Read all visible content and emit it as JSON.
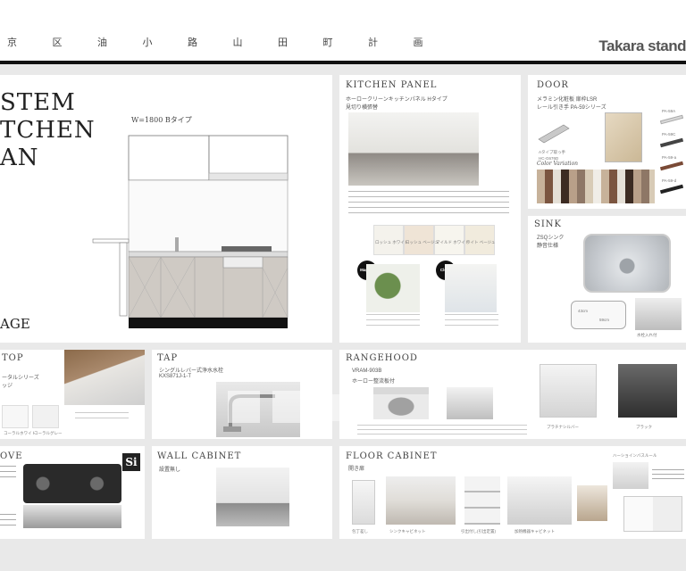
{
  "header": {
    "title": "京 区 油 小 路 山 田 町 計 画",
    "brand": "Takara stand"
  },
  "plan": {
    "title_lines": [
      "STEM",
      "TCHEN",
      "AN"
    ],
    "dimension": "W=1800  Bタイプ",
    "bottom_label": "AGE"
  },
  "kitchen_panel": {
    "heading": "KITCHEN PANEL",
    "sub1": "ホーロークリーンキッチンパネル Hタイプ",
    "sub2": "見切り横張替",
    "swatches": [
      "ロッシュ\nホワイト",
      "ロッシュ\nベージュ",
      "マイルド\nホワイト",
      "ライト\nベージュ"
    ],
    "badge_magnet": "Magnet",
    "badge_clean": "Clean"
  },
  "door": {
    "heading": "DOOR",
    "sub1": "メラミン化粧板 扉枠LSR",
    "sub2": "レール引き手 PA-59シリーズ",
    "handle_label": "Aタイプ取っ手",
    "handle_code": "HC-G676D",
    "color_variation": "Color Variation",
    "handle_names": [
      "PA-59A",
      "PA-59C",
      "PA-59-a",
      "PA-59-d"
    ]
  },
  "sink": {
    "heading": "SINK",
    "sub1": "ZSQシンク",
    "sub2": "静音仕様",
    "dim_a": "43cm",
    "dim_b": "59cm",
    "caption": "水栓入れ付"
  },
  "top": {
    "heading": "TOP",
    "sub1": "ータルシリーズ",
    "sub2": "ッジ",
    "color_a": "コーラルホワイト",
    "color_b": "コーラルグレー"
  },
  "tap": {
    "heading": "TAP",
    "sub1": "シングルレバー式浄水水栓",
    "sub2": "KXS871J-1-T"
  },
  "rangehood": {
    "heading": "RANGEHOOD",
    "sub1": "VRAM-903B",
    "sub2": "ホーロー整流板付",
    "caption_a": "プラチナシルバー",
    "caption_b": "ブラック"
  },
  "stove": {
    "heading": "OVE",
    "badge": "Si"
  },
  "wall_cabinet": {
    "heading": "WALL CABINET",
    "sub": "設置無し"
  },
  "floor_cabinet": {
    "heading": "FLOOR CABINET",
    "sub": "開き扉",
    "items": [
      "包丁差し",
      "シンクキャビネット",
      "引出付し(引出定置)",
      "加熱機器キャビネット"
    ],
    "right_label": "ハーショインバスルール",
    "note": "収納に関わる..."
  },
  "colors": {
    "page_bg": "#e9e9e9",
    "panel_bg": "#ffffff",
    "rule": "#111111",
    "cabinet_gray": "#cfcac4",
    "stove_black": "#2a2a2a"
  }
}
